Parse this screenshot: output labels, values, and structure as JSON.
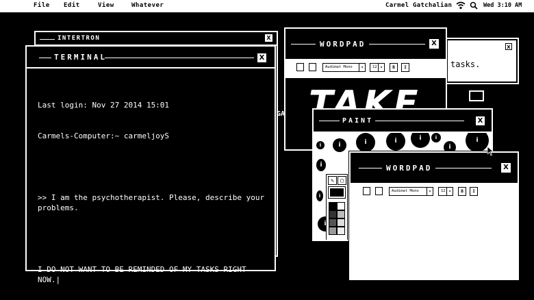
{
  "menubar": {
    "items": [
      "File",
      "Edit",
      "View",
      "Whatever"
    ],
    "user": "Carmel Gatchalian",
    "clock": "Wed 3:10 AM"
  },
  "intertron": {
    "title": "INTERTRON",
    "close": "X"
  },
  "terminal": {
    "title": "TERMINAL",
    "close": "X",
    "lines": [
      "Last login: Nov 27 2014 15:01",
      "Carmels-Computer:~ carmeljoyS",
      "",
      ">> I am the psychotherapist. Please, describe your problems.",
      "",
      "I DO NOT WANT TO BE REMINDED OF MY TASKS RIGHT NOW.|"
    ]
  },
  "tasks_window": {
    "close": "X",
    "text": "tasks."
  },
  "wordpad1": {
    "title": "WORDPAD",
    "close": "X",
    "font": "Audimat Mono",
    "size": "12",
    "bold": "B",
    "italic": "I",
    "doc_text": "TAKE"
  },
  "paint": {
    "title": "PAINT",
    "close": "X",
    "dot_char": "i"
  },
  "wordpad2": {
    "title": "WORDPAD",
    "close": "X",
    "font": "Audimat Mono",
    "size": "12",
    "bold": "B",
    "italic": "I"
  },
  "partial_text": "GA",
  "colors": {
    "background": "#000000",
    "foreground": "#ffffff"
  }
}
